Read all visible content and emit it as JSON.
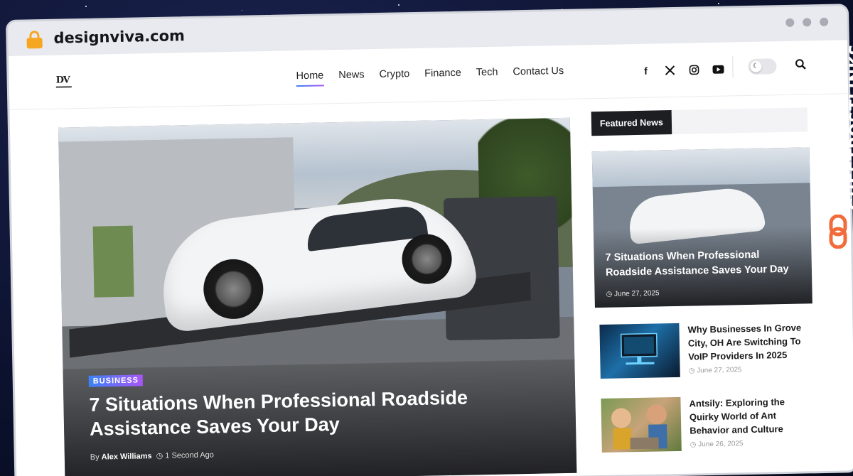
{
  "browser": {
    "url": "designviva.com"
  },
  "site": {
    "logo": "DV",
    "nav": [
      "Home",
      "News",
      "Crypto",
      "Finance",
      "Tech",
      "Contact Us"
    ],
    "social_icons": [
      "facebook-icon",
      "x-icon",
      "instagram-icon",
      "youtube-icon"
    ]
  },
  "hero": {
    "category": "BUSINESS",
    "title": "7 Situations When Professional Roadside Assistance Saves Your Day",
    "by": "By",
    "author": "Alex Williams",
    "time": "1 Second Ago"
  },
  "sidebar": {
    "heading": "Featured News",
    "featured": {
      "title": "7 Situations When Professional Roadside Assistance Saves Your Day",
      "date": "June 27, 2025"
    },
    "items": [
      {
        "title": "Why Businesses In Grove City, OH Are Switching To VoIP Providers In 2025",
        "date": "June 27, 2025"
      },
      {
        "title": "Antsily: Exploring the Quirky World of Ant Behavior and Culture",
        "date": "June 26, 2025"
      }
    ]
  },
  "watermark": "GUESTPOSTLINKS",
  "colors": {
    "accent_start": "#3b82f6",
    "accent_end": "#a855f7",
    "brand_orange": "#f26b3a",
    "lock": "#f5a623"
  }
}
